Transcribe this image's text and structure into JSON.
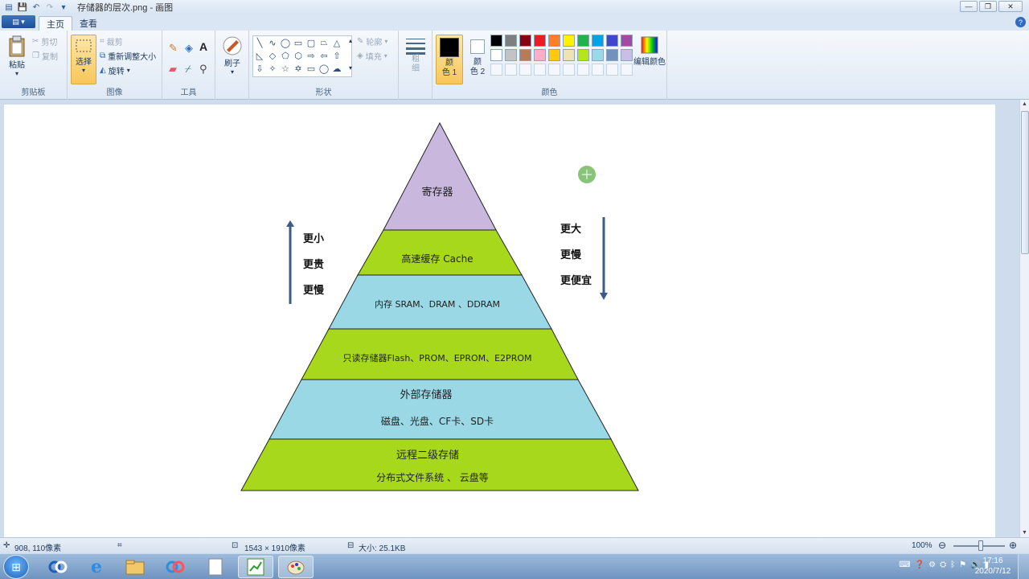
{
  "window": {
    "title": "存储器的层次.png - 画图",
    "buttons": [
      "—",
      "❐",
      "✕"
    ]
  },
  "tabs": [
    {
      "label": "主页"
    },
    {
      "label": "查看"
    }
  ],
  "ribbon": {
    "clipboard": {
      "paste": "粘贴",
      "cut": "剪切",
      "copy": "复制",
      "label": "剪贴板"
    },
    "image": {
      "select": "选择",
      "crop": "裁剪",
      "resize": "重新调整大小",
      "rotate": "旋转",
      "label": "图像"
    },
    "tools": {
      "label": "工具"
    },
    "brushes": {
      "label": "刷子"
    },
    "shapes": {
      "outline": "轮廓",
      "fill": "填充",
      "label": "形状"
    },
    "size": {
      "label": "粗\n细"
    },
    "colors": {
      "color1": "颜\n色 1",
      "color2": "颜\n色 2",
      "edit": "编辑颜色",
      "label": "颜色",
      "palette_row1": [
        "#000000",
        "#7f7f7f",
        "#880015",
        "#ed1c24",
        "#ff7f27",
        "#fff200",
        "#22b14c",
        "#00a2e8",
        "#3f48cc",
        "#a349a4"
      ],
      "palette_row2": [
        "#ffffff",
        "#c3c3c3",
        "#b97a57",
        "#ffaec9",
        "#ffc90e",
        "#efe4b0",
        "#b5e61d",
        "#99d9ea",
        "#7092be",
        "#c8bfe7"
      ]
    }
  },
  "pyramid": {
    "levels": [
      {
        "line1": "寄存器",
        "color": "#c9b7dd"
      },
      {
        "line1": "高速缓存 Cache",
        "color": "#a8d81c"
      },
      {
        "line1": "内存 SRAM、DRAM 、DDRAM",
        "color": "#9ad8e6"
      },
      {
        "line1": "只读存储器Flash、PROM、EPROM、E2PROM",
        "color": "#a8d81c"
      },
      {
        "line1": "外部存储器",
        "line2": "磁盘、光盘、CF卡、SD卡",
        "color": "#9ad8e6"
      },
      {
        "line1": "远程二级存储",
        "line2": "分布式文件系统 、 云盘等",
        "color": "#a8d81c"
      }
    ],
    "left_labels": [
      "更小",
      "更贵",
      "更慢"
    ],
    "right_labels": [
      "更大",
      "更慢",
      "更便宜"
    ]
  },
  "status": {
    "cursor": "908, 110像素",
    "dimensions": "1543 × 1910像素",
    "filesize": "大小: 25.1KB",
    "zoom": "100%"
  },
  "taskbar": {
    "time": "17:16",
    "date": "2020/7/12"
  }
}
